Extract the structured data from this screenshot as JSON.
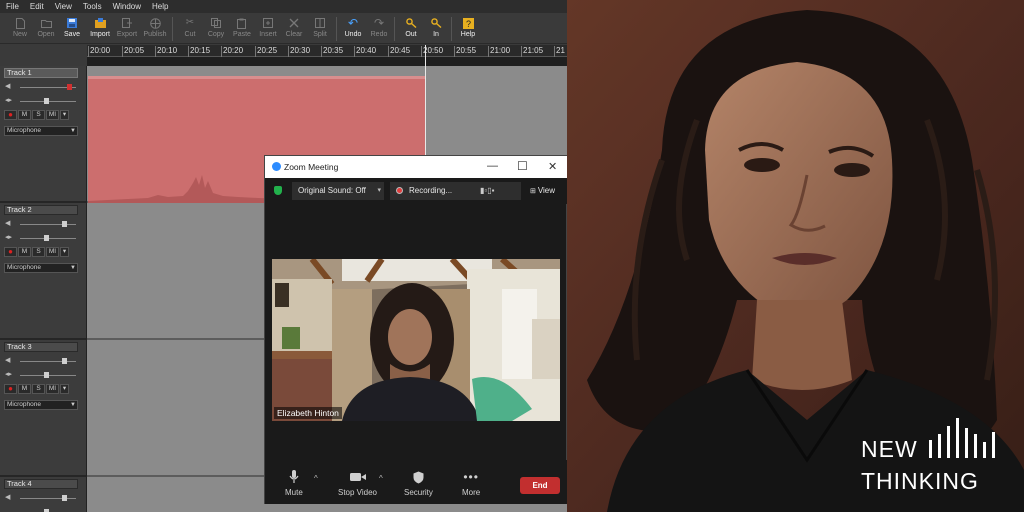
{
  "editor": {
    "menu": [
      "File",
      "Edit",
      "View",
      "Tools",
      "Window",
      "Help"
    ],
    "toolbar": [
      {
        "label": "New",
        "icon": "new-file-icon",
        "enabled": false
      },
      {
        "label": "Open",
        "icon": "open-folder-icon",
        "enabled": false
      },
      {
        "label": "Save",
        "icon": "save-icon",
        "enabled": true
      },
      {
        "label": "Import",
        "icon": "import-icon",
        "enabled": true
      },
      {
        "label": "Export",
        "icon": "export-icon",
        "enabled": false
      },
      {
        "label": "Publish",
        "icon": "globe-icon",
        "enabled": false
      },
      {
        "label": "Cut",
        "icon": "scissors-icon",
        "enabled": false
      },
      {
        "label": "Copy",
        "icon": "copy-icon",
        "enabled": false
      },
      {
        "label": "Paste",
        "icon": "paste-icon",
        "enabled": false
      },
      {
        "label": "Insert",
        "icon": "insert-icon",
        "enabled": false
      },
      {
        "label": "Clear",
        "icon": "clear-icon",
        "enabled": false
      },
      {
        "label": "Split",
        "icon": "split-icon",
        "enabled": false
      },
      {
        "label": "Undo",
        "icon": "undo-icon",
        "enabled": true
      },
      {
        "label": "Redo",
        "icon": "redo-icon",
        "enabled": false
      },
      {
        "label": "Out",
        "icon": "marker-out-icon",
        "enabled": true
      },
      {
        "label": "In",
        "icon": "marker-in-icon",
        "enabled": true
      },
      {
        "label": "Help",
        "icon": "help-icon",
        "enabled": true
      }
    ],
    "timeline_ticks": [
      "20:00",
      "20:05",
      "20:10",
      "20:15",
      "20:20",
      "20:25",
      "20:30",
      "20:35",
      "20:40",
      "20:45",
      "20:50",
      "20:55",
      "21:00",
      "21:05",
      "21"
    ],
    "tracks": [
      {
        "name": "Track 1",
        "input": "Microphone",
        "buttons": [
          "●",
          "M",
          "S",
          "MI",
          "▾"
        ],
        "selected": true
      },
      {
        "name": "Track 2",
        "input": "Microphone",
        "buttons": [
          "●",
          "M",
          "S",
          "MI",
          "▾"
        ],
        "selected": false
      },
      {
        "name": "Track 3",
        "input": "Microphone",
        "buttons": [
          "●",
          "M",
          "S",
          "MI",
          "▾"
        ],
        "selected": false
      },
      {
        "name": "Track 4",
        "input": "",
        "buttons": [],
        "selected": false
      }
    ],
    "colors": {
      "clip": "#cc6e6e",
      "lane": "#8b8b8b",
      "background": "#3a3a3a",
      "accent_undo": "#4aa3ff",
      "accent_markers": "#e8b020"
    }
  },
  "zoom": {
    "title": "Zoom Meeting",
    "original_sound": "Original Sound: Off",
    "recording": "Recording...",
    "view": "View",
    "participant": "Elizabeth Hinton",
    "controls": [
      "Mute",
      "Stop Video",
      "Security",
      "More"
    ],
    "end": "End",
    "colors": {
      "end": "#c22f2f",
      "logo": "#2d8cff",
      "shield": "#22b14c"
    }
  },
  "brand": {
    "line1": "NEW",
    "line2": "THINKING"
  }
}
